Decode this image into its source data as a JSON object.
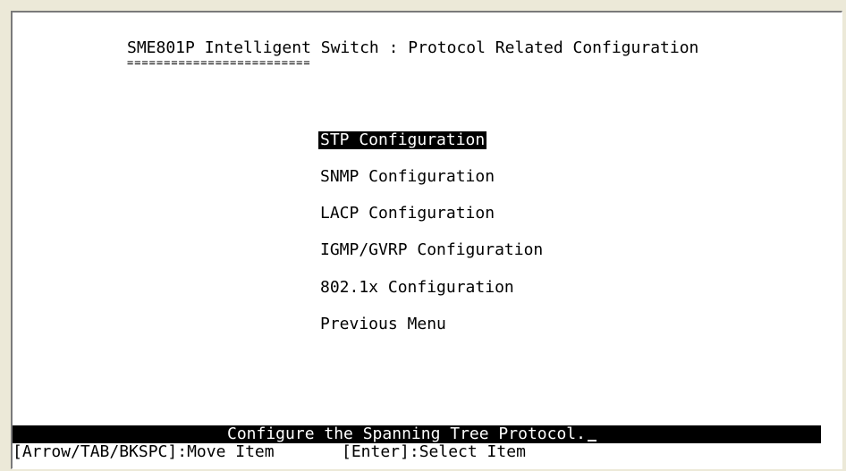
{
  "header": {
    "title": "SME801P Intelligent Switch : Protocol Related Configuration",
    "underline": "========================="
  },
  "menu": {
    "items": [
      {
        "label": "STP Configuration",
        "selected": true
      },
      {
        "label": "SNMP Configuration",
        "selected": false
      },
      {
        "label": "LACP Configuration",
        "selected": false
      },
      {
        "label": "IGMP/GVRP Configuration",
        "selected": false
      },
      {
        "label": "802.1x Configuration",
        "selected": false
      },
      {
        "label": "Previous Menu",
        "selected": false
      }
    ]
  },
  "status": {
    "message": "Configure the Spanning Tree Protocol."
  },
  "help": {
    "move": "[Arrow/TAB/BKSPC]:Move Item",
    "select": "[Enter]:Select Item"
  },
  "colors": {
    "background": "#ffffff",
    "text": "#000000",
    "highlight_bg": "#000000",
    "highlight_fg": "#ffffff"
  }
}
